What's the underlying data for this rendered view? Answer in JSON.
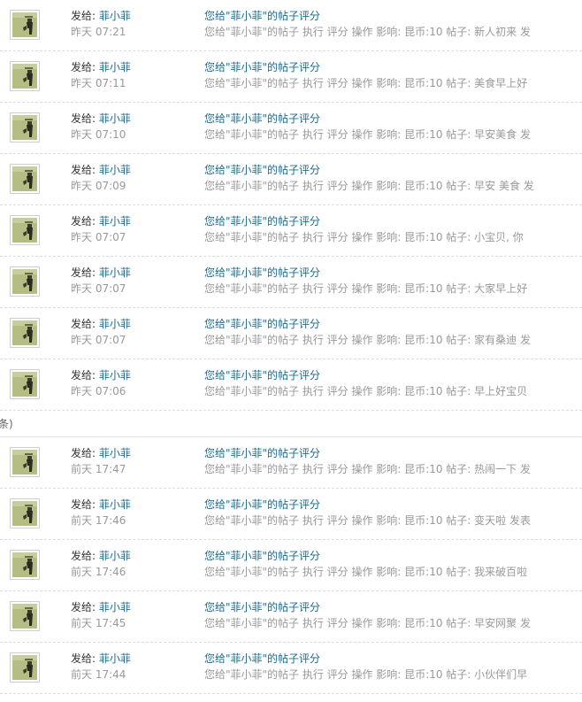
{
  "groups": [
    {
      "items": [
        {
          "sender_label": "发给:",
          "sender_name": "菲小菲",
          "time": "昨天 07:21",
          "title": "您给\"菲小菲\"的帖子评分",
          "detail": "您给\"菲小菲\"的帖子 执行 评分 操作 影响: 昆币:10 帖子: 新人初来 发"
        },
        {
          "sender_label": "发给:",
          "sender_name": "菲小菲",
          "time": "昨天 07:11",
          "title": "您给\"菲小菲\"的帖子评分",
          "detail": "您给\"菲小菲\"的帖子 执行 评分 操作 影响: 昆币:10 帖子: 美食早上好"
        },
        {
          "sender_label": "发给:",
          "sender_name": "菲小菲",
          "time": "昨天 07:10",
          "title": "您给\"菲小菲\"的帖子评分",
          "detail": "您给\"菲小菲\"的帖子 执行 评分 操作 影响: 昆币:10 帖子: 早安美食 发"
        },
        {
          "sender_label": "发给:",
          "sender_name": "菲小菲",
          "time": "昨天 07:09",
          "title": "您给\"菲小菲\"的帖子评分",
          "detail": "您给\"菲小菲\"的帖子 执行 评分 操作 影响: 昆币:10 帖子: 早安 美食 发"
        },
        {
          "sender_label": "发给:",
          "sender_name": "菲小菲",
          "time": "昨天 07:07",
          "title": "您给\"菲小菲\"的帖子评分",
          "detail": "您给\"菲小菲\"的帖子 执行 评分 操作 影响: 昆币:10 帖子: 小宝贝, 你"
        },
        {
          "sender_label": "发给:",
          "sender_name": "菲小菲",
          "time": "昨天 07:07",
          "title": "您给\"菲小菲\"的帖子评分",
          "detail": "您给\"菲小菲\"的帖子 执行 评分 操作 影响: 昆币:10 帖子: 大家早上好"
        },
        {
          "sender_label": "发给:",
          "sender_name": "菲小菲",
          "time": "昨天 07:07",
          "title": "您给\"菲小菲\"的帖子评分",
          "detail": "您给\"菲小菲\"的帖子 执行 评分 操作 影响: 昆币:10 帖子: 家有桑迪 发"
        },
        {
          "sender_label": "发给:",
          "sender_name": "菲小菲",
          "time": "昨天 07:06",
          "title": "您给\"菲小菲\"的帖子评分",
          "detail": "您给\"菲小菲\"的帖子 执行 评分 操作 影响: 昆币:10 帖子: 早上好宝贝"
        }
      ]
    },
    {
      "header": "条)",
      "items": [
        {
          "sender_label": "发给:",
          "sender_name": "菲小菲",
          "time": "前天 17:47",
          "title": "您给\"菲小菲\"的帖子评分",
          "detail": "您给\"菲小菲\"的帖子 执行 评分 操作 影响: 昆币:10 帖子: 热闹一下 发"
        },
        {
          "sender_label": "发给:",
          "sender_name": "菲小菲",
          "time": "前天 17:46",
          "title": "您给\"菲小菲\"的帖子评分",
          "detail": "您给\"菲小菲\"的帖子 执行 评分 操作 影响: 昆币:10 帖子: 变天啦 发表"
        },
        {
          "sender_label": "发给:",
          "sender_name": "菲小菲",
          "time": "前天 17:46",
          "title": "您给\"菲小菲\"的帖子评分",
          "detail": "您给\"菲小菲\"的帖子 执行 评分 操作 影响: 昆币:10 帖子: 我来破百啦"
        },
        {
          "sender_label": "发给:",
          "sender_name": "菲小菲",
          "time": "前天 17:45",
          "title": "您给\"菲小菲\"的帖子评分",
          "detail": "您给\"菲小菲\"的帖子 执行 评分 操作 影响: 昆币:10 帖子: 早安网聚 发"
        },
        {
          "sender_label": "发给:",
          "sender_name": "菲小菲",
          "time": "前天 17:44",
          "title": "您给\"菲小菲\"的帖子评分",
          "detail": "您给\"菲小菲\"的帖子 执行 评分 操作 影响: 昆币:10 帖子: 小伙伴们早"
        }
      ]
    }
  ],
  "avatar_icon": "user-avatar-icon",
  "colors": {
    "link": "#1f6a8a",
    "muted": "#999999",
    "avatar_bg": "#b5bd84"
  }
}
